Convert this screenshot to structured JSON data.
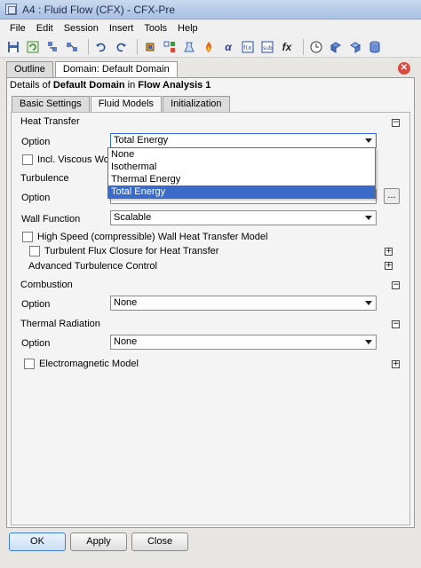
{
  "window": {
    "title": "A4 : Fluid Flow (CFX) - CFX-Pre"
  },
  "menu": [
    "File",
    "Edit",
    "Session",
    "Insert",
    "Tools",
    "Help"
  ],
  "toolbar_icons": [
    "save-icon",
    "refresh-icon",
    "import-icon",
    "export-icon",
    "undo-icon",
    "redo-icon",
    "domain-icon",
    "boundary-icon",
    "subdomain-icon",
    "flame-icon",
    "variable-icon",
    "expression-icon",
    "user-function-icon",
    "function-icon",
    "clock-icon",
    "mesh-icon",
    "solver-icon",
    "database-icon"
  ],
  "panel_tabs": {
    "outline": "Outline",
    "domain": "Domain: Default Domain"
  },
  "details": {
    "prefix": "Details of ",
    "object": "Default Domain",
    "mid": " in ",
    "analysis": "Flow Analysis 1"
  },
  "sub_tabs": {
    "basic": "Basic Settings",
    "fluid": "Fluid Models",
    "init": "Initialization"
  },
  "heat_transfer": {
    "title": "Heat Transfer",
    "option_label": "Option",
    "option_value": "Total Energy",
    "viscous_label": "Incl. Viscous Work Te",
    "dropdown_options": [
      "None",
      "Isothermal",
      "Thermal Energy",
      "Total Energy"
    ],
    "dropdown_selected": "Total Energy"
  },
  "turbulence": {
    "title": "Turbulence",
    "option_label": "Option",
    "wall_function_label": "Wall Function",
    "wall_function_value": "Scalable",
    "high_speed_label": "High Speed (compressible) Wall Heat Transfer Model",
    "flux_closure_label": "Turbulent Flux Closure for Heat Transfer",
    "advanced_label": "Advanced Turbulence Control",
    "ellipsis": "..."
  },
  "combustion": {
    "title": "Combustion",
    "option_label": "Option",
    "option_value": "None"
  },
  "thermal_radiation": {
    "title": "Thermal Radiation",
    "option_label": "Option",
    "option_value": "None"
  },
  "electromagnetic": {
    "label": "Electromagnetic Model"
  },
  "buttons": {
    "ok": "OK",
    "apply": "Apply",
    "close": "Close"
  },
  "symbols": {
    "minus": "−",
    "plus": "+",
    "close_x": "✕"
  }
}
